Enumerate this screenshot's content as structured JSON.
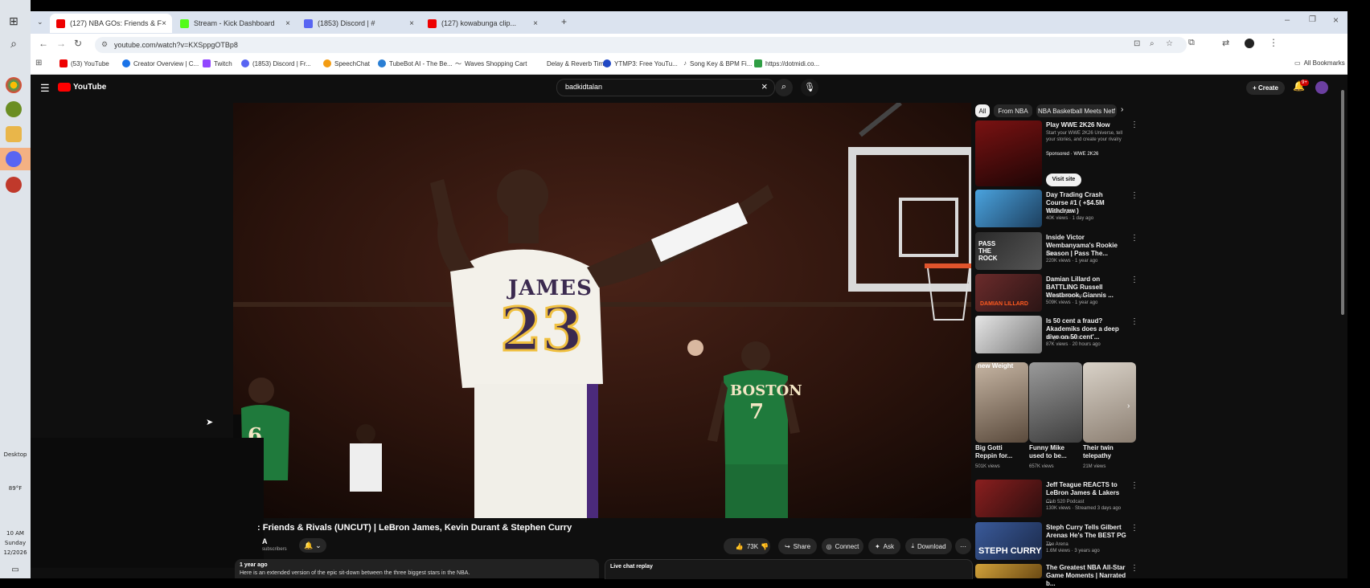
{
  "browser": {
    "tabs": [
      {
        "label": "(127) NBA GOs: Friends & F",
        "color": "#e00"
      },
      {
        "label": "Stream - Kick Dashboard",
        "color": "#53fc18"
      },
      {
        "label": "(1853) Discord | #",
        "color": "#5865f2"
      },
      {
        "label": "(127) kowabunga clip...",
        "color": "#e00"
      }
    ],
    "new_tab": "+",
    "url": "youtube.com/watch?v=KXSppgOTBp8",
    "bookmarks": [
      "(53) YouTube",
      "Creator Overview | C...",
      "Twitch",
      "(1853) Discord | Fr...",
      "SpeechChat",
      "TubeBot AI - The Be...",
      "Waves Shopping Cart",
      "Delay & Reverb Tim...",
      "YTMP3: Free YouTu...",
      "Song Key & BPM Fi...",
      "https://dotmidi.co..."
    ],
    "all_bookmarks": "All Bookmarks"
  },
  "taskbar": {
    "weather": "89°F",
    "time": "10 AM",
    "day": "Sunday",
    "date": "12/2026",
    "desktop": "Desktop"
  },
  "youtube": {
    "logo": "YouTube",
    "search_value": "badkidtalan",
    "create_label": "+ Create",
    "notifications_badge": "9+",
    "chips": [
      "All",
      "From NBA",
      "NBA Basketball Meets Netf"
    ],
    "video_title": ": Friends & Rivals (UNCUT) | LeBron James, Kevin Durant & Stephen Curry",
    "channel_short": "A",
    "channel_sub": "subscribers",
    "likes": "73K",
    "actions": [
      "Share",
      "Connect",
      "Ask",
      "Download"
    ],
    "desc_meta": "1 year ago",
    "desc_text": "Here is an extended version of the epic sit-down between the three biggest stars in the NBA.",
    "live_chat": "Live chat replay",
    "jersey_name": "JAMES",
    "jersey_number": "23",
    "opponent_team": "BOSTON",
    "opponent_number": "7",
    "opponent_left_number": "6",
    "ad": {
      "title": "Play WWE 2K26 Now",
      "desc": "Start your WWE 2K26 Universe, tell your stories, and create your rivalry",
      "sponsor": "Sponsored · WWE 2K26",
      "button": "Visit site"
    },
    "recs": [
      {
        "title": "Day Trading Crash Course #1 ( +$4.5M Withdraw )",
        "channel": "Trades By Sci",
        "meta": "40K views · 1 day ago",
        "duration": "14:56"
      },
      {
        "title": "Inside Victor Wembanyama's Rookie Season | Pass The...",
        "channel": "NBA",
        "meta": "220K views · 1 year ago",
        "duration": "33:05"
      },
      {
        "title": "Damian Lillard on BATTLING Russell Westbrook, Giannis ...",
        "channel": "Club 520 Podcast",
        "meta": "509K views · 1 year ago",
        "duration": "1:36:21"
      },
      {
        "title": "Is 50 cent a fraud? Akademiks does a deep dive on 50 cent'...",
        "channel": "King Akademiks",
        "meta": "87K views · 20 hours ago",
        "duration": "1:22:18"
      }
    ],
    "shorts_heading": "new Weight",
    "shorts": [
      {
        "title": "Big Gotti Reppin for...",
        "views": "501K views"
      },
      {
        "title": "Funny Mike used to be...",
        "views": "657K views"
      },
      {
        "title": "Their twin telepathy",
        "views": "21M views"
      }
    ],
    "recs2": [
      {
        "title": "Jeff Teague REACTS to LeBron James & Lakers ...",
        "channel": "Club 520 Podcast",
        "meta": "130K views · Streamed 3 days ago"
      },
      {
        "title": "Steph Curry Tells Gilbert Arenas He's The BEST PG ...",
        "channel": "The Arena",
        "meta": "1.6M views · 3 years ago"
      },
      {
        "title": "The Greatest NBA All-Star Game Moments | Narrated b...",
        "channel": "",
        "meta": ""
      }
    ],
    "thumb_texts": [
      "PASS THE ROCK",
      "DAMIAN LILLARD",
      "STEPH CURRY"
    ]
  }
}
